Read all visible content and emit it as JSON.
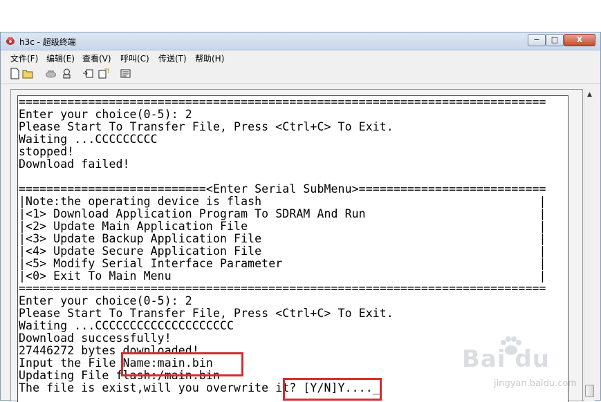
{
  "window": {
    "title": "h3c - 超级终端",
    "min_label": "−",
    "max_label": "□",
    "close_label": "X"
  },
  "menubar": {
    "items": [
      {
        "label": "文件(F)"
      },
      {
        "label": "编辑(E)"
      },
      {
        "label": "查看(V)"
      },
      {
        "label": "呼叫(C)"
      },
      {
        "label": "传送(T)"
      },
      {
        "label": "帮助(H)"
      }
    ]
  },
  "toolbar": {
    "icons": [
      "new-icon",
      "open-icon",
      "phone-icon",
      "dial-icon",
      "send-icon",
      "receive-icon",
      "properties-icon"
    ]
  },
  "terminal": {
    "lines": [
      "============================================================================",
      "Enter your choice(0-5): 2",
      "Please Start To Transfer File, Press <Ctrl+C> To Exit.",
      "Waiting ...CCCCCCCCC",
      "stopped!",
      "Download failed!",
      "",
      "===========================<Enter Serial SubMenu>===========================",
      "|Note:the operating device is flash                                        |",
      "|<1> Download Application Program To SDRAM And Run                         |",
      "|<2> Update Main Application File                                          |",
      "|<3> Update Backup Application File                                        |",
      "|<4> Update Secure Application File                                        |",
      "|<5> Modify Serial Interface Parameter                                     |",
      "|<0> Exit To Main Menu                                                     |",
      "============================================================================",
      "Enter your choice(0-5): 2",
      "Please Start To Transfer File, Press <Ctrl+C> To Exit.",
      "Waiting ...CCCCCCCCCCCCCCCCCCCC",
      "Download successfully!",
      "27446272 bytes downloaded!",
      "Input the File Name:main.bin",
      "Updating File flash:/main.bin",
      "The file is exist,will you overwrite it? [Y/N]Y...._"
    ]
  },
  "watermark": {
    "brand": "Bai du",
    "url": "jingyan.baidu.com"
  },
  "colors": {
    "highlight": "#d42c2c",
    "terminal_bg": "#ffffff",
    "terminal_text": "#000000"
  }
}
